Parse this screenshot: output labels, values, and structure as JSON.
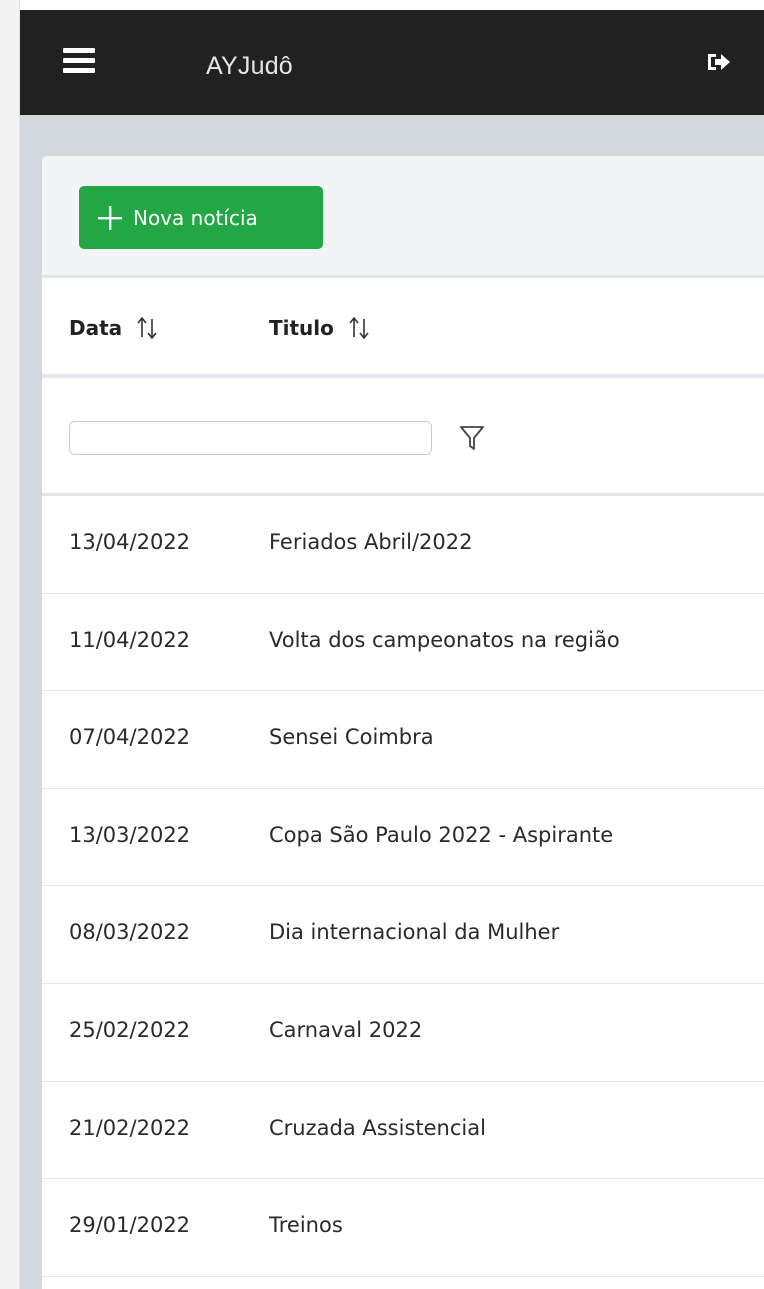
{
  "app": {
    "title": "AYJudô"
  },
  "header": {
    "menu_icon": "hamburger-icon",
    "logout_icon": "logout-icon"
  },
  "toolbar": {
    "new_button_label": "Nova notícia",
    "new_button_icon": "plus-icon",
    "new_button_color": "#22a744"
  },
  "table": {
    "columns": [
      {
        "label": "Data",
        "sort_icon": "sort-icon"
      },
      {
        "label": "Titulo",
        "sort_icon": "sort-icon"
      }
    ],
    "filter": {
      "value": "",
      "placeholder": "",
      "icon": "filter-icon"
    },
    "rows": [
      {
        "date": "13/04/2022",
        "title": "Feriados Abril/2022"
      },
      {
        "date": "11/04/2022",
        "title": "Volta dos campeonatos na região"
      },
      {
        "date": "07/04/2022",
        "title": "Sensei Coimbra"
      },
      {
        "date": "13/03/2022",
        "title": "Copa São Paulo 2022 - Aspirante"
      },
      {
        "date": "08/03/2022",
        "title": "Dia internacional da Mulher"
      },
      {
        "date": "25/02/2022",
        "title": "Carnaval 2022"
      },
      {
        "date": "21/02/2022",
        "title": "Cruzada Assistencial"
      },
      {
        "date": "29/01/2022",
        "title": "Treinos"
      }
    ]
  },
  "colors": {
    "topbar": "#212121",
    "background": "#d2d8de",
    "accent": "#22a744"
  }
}
